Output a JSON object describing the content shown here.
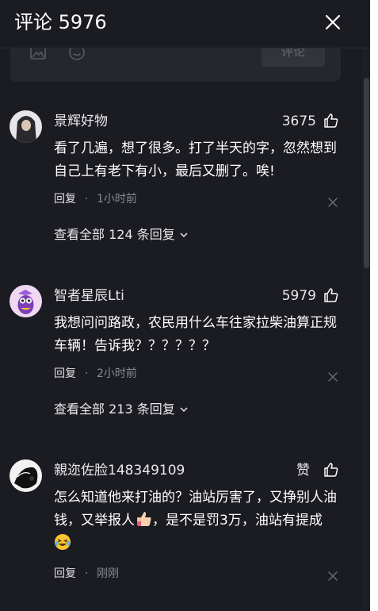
{
  "header": {
    "title": "评论 5976",
    "close_icon": "close-icon"
  },
  "composer": {
    "submit_label": "评论",
    "icons": [
      "image-icon",
      "emoji-icon"
    ]
  },
  "comments": [
    {
      "user": "景辉好物",
      "likes": "3675",
      "text": "看了几遍，想了很多。打了半天的字，忽然想到自己上有老下有小，最后又删了。唉!",
      "reply_label": "回复",
      "separator": "·",
      "time": "1小时前",
      "view_all": "查看全部 124 条回复"
    },
    {
      "user": "智者星辰Lti",
      "likes": "5979",
      "text": "我想问问路政，农民用什么车往家拉柴油算正规车辆！告诉我？？？？？？",
      "reply_label": "回复",
      "separator": "·",
      "time": "2小时前",
      "view_all": "查看全部 213 条回复"
    },
    {
      "user": "親迩佐脸148349109",
      "likes": "赞",
      "text_part1": "怎么知道他来打油的？油站厉害了，又挣别人油钱，又举报人",
      "text_part2": "，是不是罚3万，油站有提成",
      "reply_label": "回复",
      "separator": "·",
      "time": "刚刚"
    }
  ],
  "colors": {
    "background": "#1b1b22",
    "composer": "#26262e",
    "muted": "#8a8a92"
  }
}
